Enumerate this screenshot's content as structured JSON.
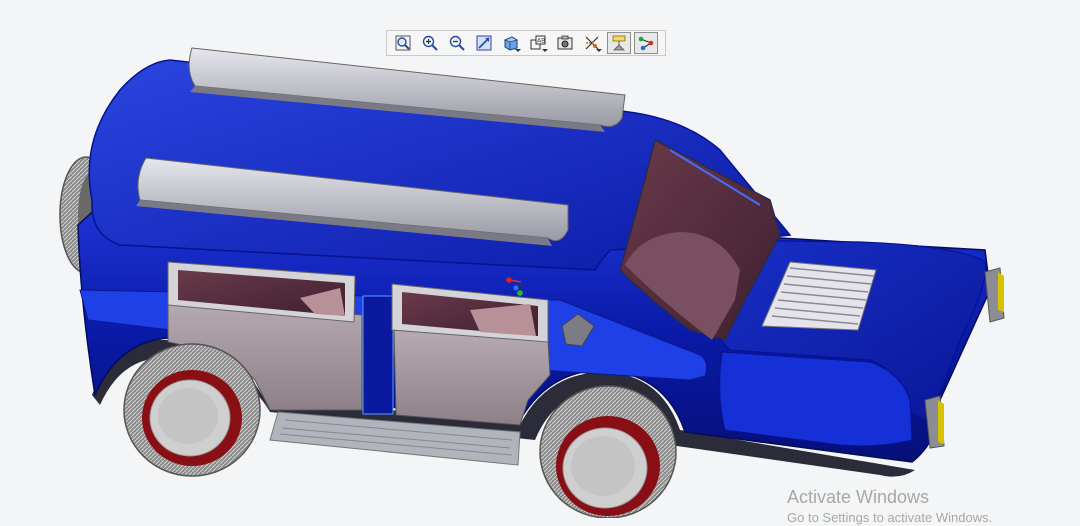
{
  "toolbar": {
    "buttons": [
      {
        "name": "zoom-fit-button",
        "icon": "zoom-fit-icon",
        "active": false
      },
      {
        "name": "zoom-in-button",
        "icon": "zoom-in-icon",
        "active": false
      },
      {
        "name": "zoom-out-button",
        "icon": "zoom-out-icon",
        "active": false
      },
      {
        "name": "repaint-button",
        "icon": "repaint-icon",
        "active": false
      },
      {
        "name": "display-style-button",
        "icon": "display-style-icon",
        "active": false,
        "dropdown": true
      },
      {
        "name": "saved-orientations-button",
        "icon": "saved-views-icon",
        "active": false,
        "dropdown": true
      },
      {
        "name": "view-manager-button",
        "icon": "view-manager-icon",
        "active": false
      },
      {
        "name": "datum-display-button",
        "icon": "datum-display-icon",
        "active": false,
        "dropdown": true
      },
      {
        "name": "annotation-display-button",
        "icon": "annotation-display-icon",
        "active": true
      },
      {
        "name": "spin-center-button",
        "icon": "spin-center-icon",
        "active": true
      }
    ]
  },
  "model": {
    "body_color": "#0a1aa8",
    "stripe_color": "#1f40e6",
    "rack_color": "#c4c4cc",
    "glass_color": "#5a3040",
    "rim_color": "#8a0f14",
    "tire_color": "#8a8a8a",
    "lamp_color": "#d8c200"
  },
  "watermark": {
    "title": "Activate Windows",
    "subtitle": "Go to Settings to activate Windows."
  }
}
